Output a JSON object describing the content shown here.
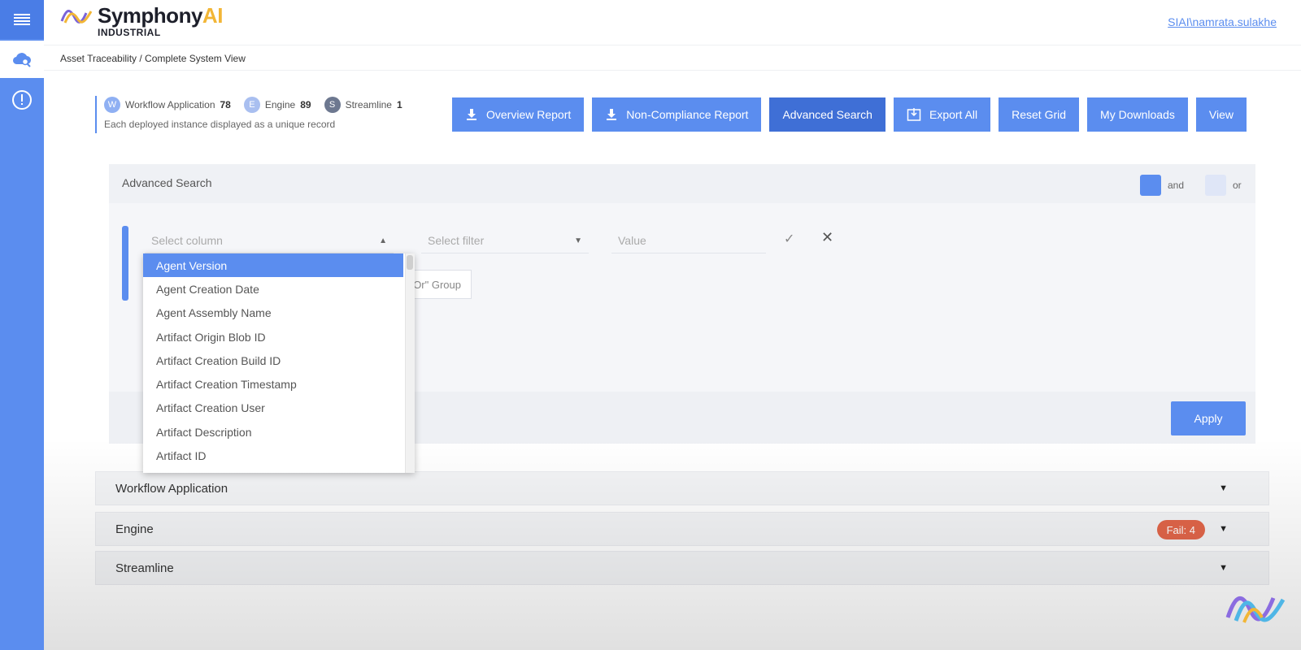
{
  "header": {
    "brand_name": "Symphony",
    "brand_ai": "AI",
    "brand_sub": "INDUSTRIAL",
    "user": "SIAI\\namrata.sulakhe"
  },
  "breadcrumb": "Asset Traceability / Complete System View",
  "summary": {
    "items": [
      {
        "letter": "W",
        "label": "Workflow Application",
        "count": "78"
      },
      {
        "letter": "E",
        "label": "Engine",
        "count": "89"
      },
      {
        "letter": "S",
        "label": "Streamline",
        "count": "1"
      }
    ],
    "note": "Each deployed instance displayed as a unique record"
  },
  "toolbar": {
    "overview": "Overview Report",
    "noncompliance": "Non-Compliance Report",
    "advanced": "Advanced Search",
    "export": "Export All",
    "reset": "Reset Grid",
    "downloads": "My Downloads",
    "view": "View"
  },
  "advanced_search": {
    "title": "Advanced Search",
    "and_label": "and",
    "or_label": "or",
    "column_placeholder": "Select column",
    "filter_placeholder": "Select filter",
    "value_placeholder": "Value",
    "group_label": "Or\" Group",
    "apply": "Apply"
  },
  "dropdown": {
    "options": [
      "Agent Version",
      "Agent Creation Date",
      "Agent Assembly Name",
      "Artifact Origin Blob ID",
      "Artifact Creation Build ID",
      "Artifact Creation Timestamp",
      "Artifact Creation User",
      "Artifact Description",
      "Artifact ID"
    ],
    "selected_index": 0
  },
  "sections": [
    {
      "label": "Workflow Application"
    },
    {
      "label": "Engine",
      "badge": "Fail: 4"
    },
    {
      "label": "Streamline"
    }
  ],
  "colors": {
    "primary": "#5b8def",
    "fail": "#e2664a",
    "brand_ai": "#f2b636"
  }
}
